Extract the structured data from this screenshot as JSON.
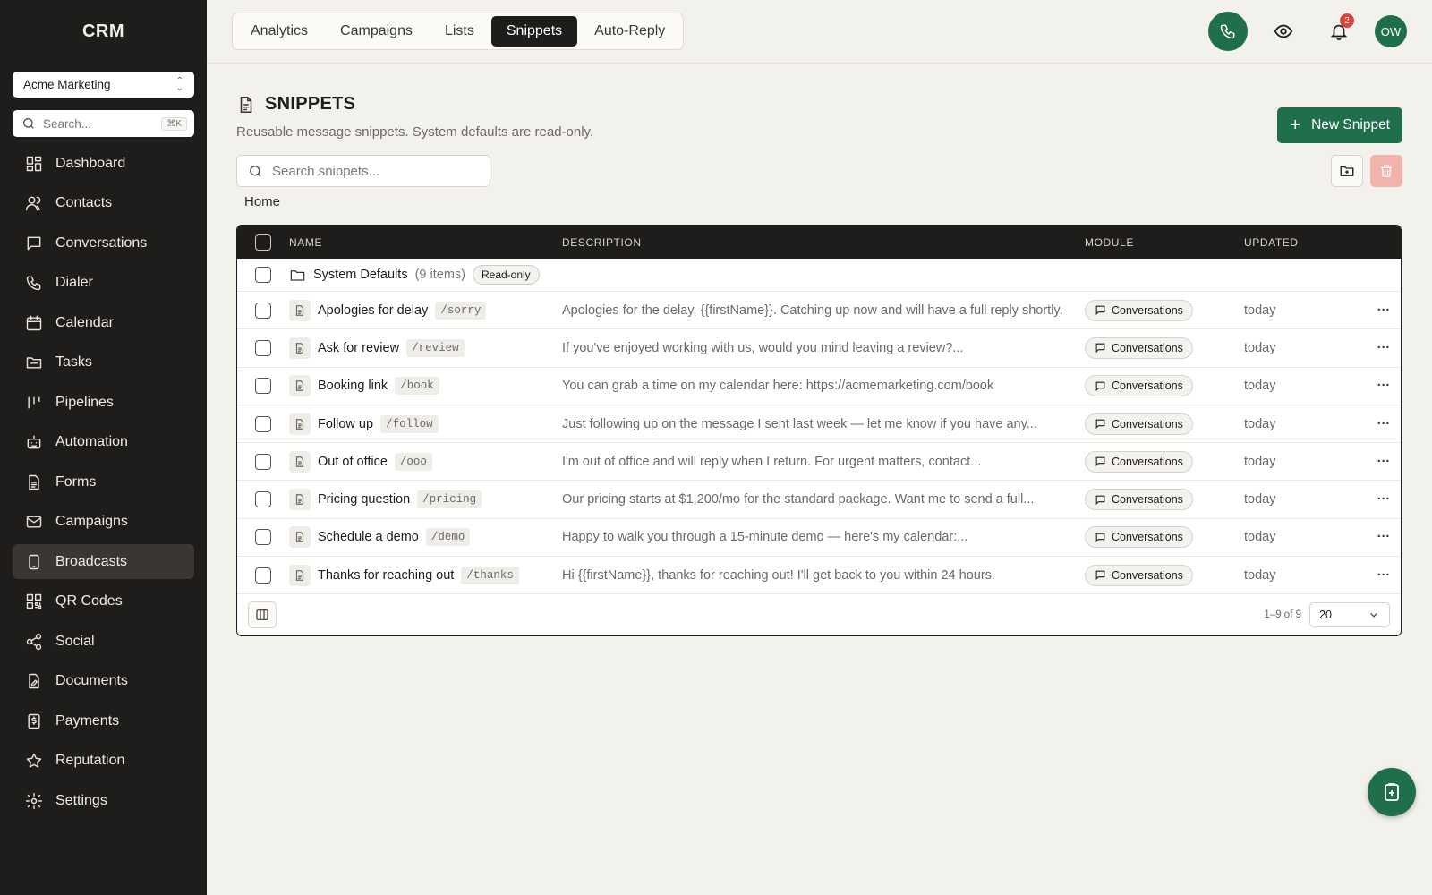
{
  "app": {
    "brand": "CRM"
  },
  "sidebar": {
    "workspace": "Acme Marketing",
    "search_placeholder": "Search...",
    "search_shortcut": "⌘K",
    "items": [
      {
        "label": "Dashboard",
        "icon": "dashboard-icon"
      },
      {
        "label": "Contacts",
        "icon": "contacts-icon"
      },
      {
        "label": "Conversations",
        "icon": "conversations-icon"
      },
      {
        "label": "Dialer",
        "icon": "phone-icon"
      },
      {
        "label": "Calendar",
        "icon": "calendar-icon"
      },
      {
        "label": "Tasks",
        "icon": "tasks-icon"
      },
      {
        "label": "Pipelines",
        "icon": "pipelines-icon"
      },
      {
        "label": "Automation",
        "icon": "robot-icon"
      },
      {
        "label": "Forms",
        "icon": "forms-icon"
      },
      {
        "label": "Campaigns",
        "icon": "mail-icon"
      },
      {
        "label": "Broadcasts",
        "icon": "broadcast-icon",
        "active": true
      },
      {
        "label": "QR Codes",
        "icon": "qr-icon"
      },
      {
        "label": "Social",
        "icon": "share-icon"
      },
      {
        "label": "Documents",
        "icon": "documents-icon"
      },
      {
        "label": "Payments",
        "icon": "payments-icon"
      },
      {
        "label": "Reputation",
        "icon": "star-icon"
      },
      {
        "label": "Settings",
        "icon": "gear-icon"
      }
    ]
  },
  "topbar": {
    "tabs": [
      {
        "label": "Analytics"
      },
      {
        "label": "Campaigns"
      },
      {
        "label": "Lists"
      },
      {
        "label": "Snippets",
        "active": true
      },
      {
        "label": "Auto-Reply"
      }
    ],
    "notification_count": "2",
    "avatar_initials": "OW"
  },
  "page": {
    "title": "SNIPPETS",
    "subtitle": "Reusable message snippets. System defaults are read-only.",
    "new_button": "New Snippet",
    "search_placeholder": "Search snippets...",
    "breadcrumb": "Home"
  },
  "table": {
    "headers": {
      "name": "NAME",
      "description": "DESCRIPTION",
      "module": "MODULE",
      "updated": "UPDATED"
    },
    "folder": {
      "name": "System Defaults",
      "count": "(9 items)",
      "badge": "Read-only"
    },
    "rows": [
      {
        "name": "Apologies for delay",
        "shortcut": "/sorry",
        "description": "Apologies for the delay, {{firstName}}. Catching up now and will have a full reply shortly.",
        "module": "Conversations",
        "updated": "today"
      },
      {
        "name": "Ask for review",
        "shortcut": "/review",
        "description": "If you've enjoyed working with us, would you mind leaving a review?...",
        "module": "Conversations",
        "updated": "today"
      },
      {
        "name": "Booking link",
        "shortcut": "/book",
        "description": "You can grab a time on my calendar here: https://acmemarketing.com/book",
        "module": "Conversations",
        "updated": "today"
      },
      {
        "name": "Follow up",
        "shortcut": "/follow",
        "description": "Just following up on the message I sent last week — let me know if you have any...",
        "module": "Conversations",
        "updated": "today"
      },
      {
        "name": "Out of office",
        "shortcut": "/ooo",
        "description": "I'm out of office and will reply when I return. For urgent matters, contact...",
        "module": "Conversations",
        "updated": "today"
      },
      {
        "name": "Pricing question",
        "shortcut": "/pricing",
        "description": "Our pricing starts at $1,200/mo for the standard package. Want me to send a full...",
        "module": "Conversations",
        "updated": "today"
      },
      {
        "name": "Schedule a demo",
        "shortcut": "/demo",
        "description": "Happy to walk you through a 15-minute demo — here's my calendar:...",
        "module": "Conversations",
        "updated": "today"
      },
      {
        "name": "Thanks for reaching out",
        "shortcut": "/thanks",
        "description": "Hi {{firstName}}, thanks for reaching out! I'll get back to you within 24 hours.",
        "module": "Conversations",
        "updated": "today"
      }
    ],
    "footer": {
      "range": "1–9 of 9",
      "page_size": "20"
    }
  },
  "colors": {
    "sidebar_bg": "#1f1d1b",
    "accent_green": "#1f6f4d",
    "danger_soft": "#f2b3ad",
    "page_bg": "#f3f1ec"
  }
}
